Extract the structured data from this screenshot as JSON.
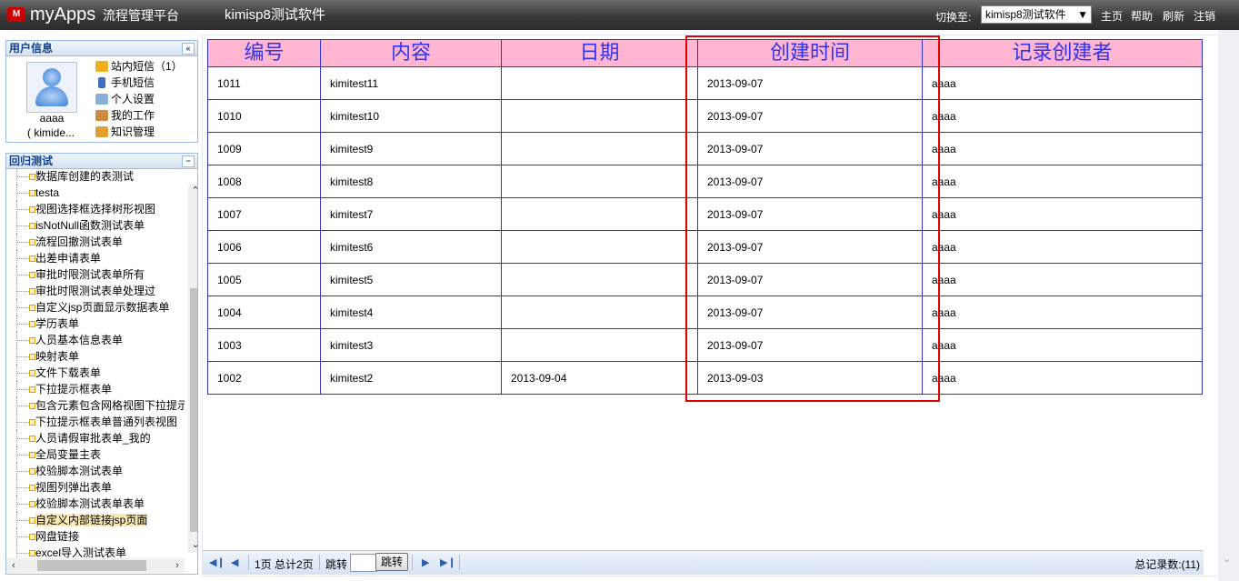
{
  "header": {
    "logo_mark": "M",
    "logo_text": "myApps",
    "logo_sub": "流程管理平台",
    "app_name": "kimisp8测试软件",
    "switch_label": "切换至:",
    "switch_value": "kimisp8测试软件",
    "links": [
      "主页",
      "帮助",
      "刷新",
      "注销"
    ]
  },
  "user_panel": {
    "title": "用户信息",
    "name": "aaaa",
    "id": "( kimide...",
    "menu": [
      {
        "label": "站内短信（1）",
        "icon": "envelope-icon"
      },
      {
        "label": "手机短信",
        "icon": "mobile-phone-icon"
      },
      {
        "label": "个人设置",
        "icon": "edit-icon"
      },
      {
        "label": "我的工作",
        "icon": "worker-icon"
      },
      {
        "label": "知识管理",
        "icon": "knowledge-icon"
      }
    ]
  },
  "tree_panel": {
    "title": "回归测试",
    "items": [
      "数据库创建的表测试",
      "testa",
      "视图选择框选择树形视图",
      "isNotNull函数测试表单",
      "流程回撤测试表单",
      "出差申请表单",
      "审批时限测试表单所有",
      "审批时限测试表单处理过",
      "自定义jsp页面显示数据表单",
      "学历表单",
      "人员基本信息表单",
      "映射表单",
      "文件下载表单",
      "下拉提示框表单",
      "包含元素包含网格视图下拉提示",
      "下拉提示框表单普通列表视图",
      "人员请假审批表单_我的",
      "全局变量主表",
      "校验脚本测试表单",
      "视图列弹出表单",
      "校验脚本测试表单表单",
      "自定义内部链接jsp页面",
      "网盘链接",
      "excel导入测试表单"
    ],
    "selected_index": 21
  },
  "table": {
    "columns": [
      "编号",
      "内容",
      "日期",
      "创建时间",
      "记录创建者"
    ],
    "rows": [
      [
        "1011",
        "kimitest11",
        "",
        "2013-09-07",
        "aaaa"
      ],
      [
        "1010",
        "kimitest10",
        "",
        "2013-09-07",
        "aaaa"
      ],
      [
        "1009",
        "kimitest9",
        "",
        "2013-09-07",
        "aaaa"
      ],
      [
        "1008",
        "kimitest8",
        "",
        "2013-09-07",
        "aaaa"
      ],
      [
        "1007",
        "kimitest7",
        "",
        "2013-09-07",
        "aaaa"
      ],
      [
        "1006",
        "kimitest6",
        "",
        "2013-09-07",
        "aaaa"
      ],
      [
        "1005",
        "kimitest5",
        "",
        "2013-09-07",
        "aaaa"
      ],
      [
        "1004",
        "kimitest4",
        "",
        "2013-09-07",
        "aaaa"
      ],
      [
        "1003",
        "kimitest3",
        "",
        "2013-09-07",
        "aaaa"
      ],
      [
        "1002",
        "kimitest2",
        "2013-09-04",
        "2013-09-03",
        "aaaa"
      ]
    ]
  },
  "pager": {
    "page_info": "1页 总计2页",
    "jump_label": "跳转",
    "jump_value": "",
    "jump_button": "跳转",
    "total": "总记录数:(11)"
  },
  "colors": {
    "header_bg": "#ffb6d2",
    "header_text": "#3333ee",
    "border": "#3333cc",
    "highlight": "#e10000"
  }
}
